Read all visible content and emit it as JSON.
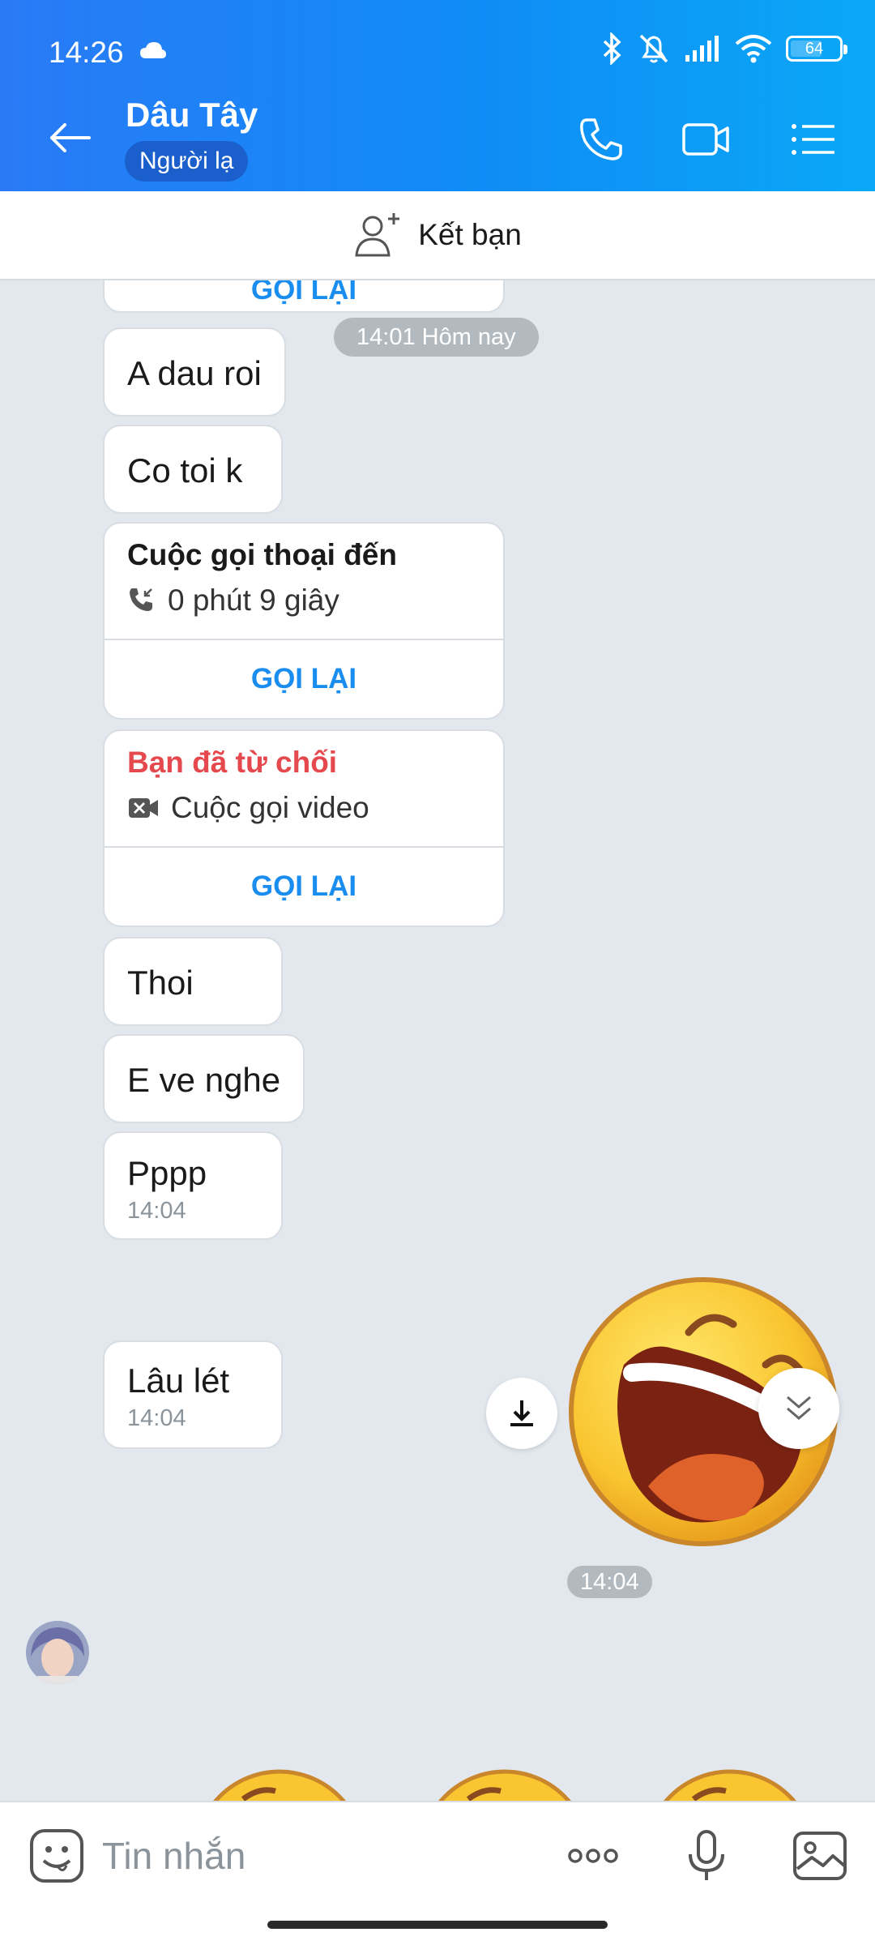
{
  "status_bar": {
    "time": "14:26",
    "battery": "64"
  },
  "header": {
    "contact_name": "Dâu Tây",
    "badge": "Người lạ"
  },
  "friend_bar": {
    "label": "Kết bạn"
  },
  "chat": {
    "top_partial_action": "GỌI LẠI",
    "date_pill": "14:01 Hôm nay",
    "messages": [
      {
        "text": "A dau roi"
      },
      {
        "text": "Co toi k"
      },
      {
        "text": "Thoi"
      },
      {
        "text": "E ve nghe"
      },
      {
        "text": "Pppp",
        "time": "14:04"
      },
      {
        "text": "Lâu lét",
        "time": "14:04"
      }
    ],
    "call_incoming": {
      "title": "Cuộc gọi thoại đến",
      "detail": "0 phút 9 giây",
      "action": "GỌI LẠI"
    },
    "call_declined": {
      "title": "Bạn đã từ chối",
      "detail": "Cuộc gọi video",
      "action": "GỌI LẠI",
      "title_color": "#e5484d"
    },
    "sticker_time": "14:04"
  },
  "input_bar": {
    "placeholder": "Tin nhắn"
  },
  "colors": {
    "accent": "#1a8df0",
    "header_start": "#2a7af6",
    "header_end": "#0aa8f7",
    "chat_bg": "#e2e8ee"
  },
  "icons": [
    "back-arrow-icon",
    "phone-icon",
    "video-call-icon",
    "menu-list-icon",
    "add-friend-icon",
    "sticker-icon",
    "more-icon",
    "microphone-icon",
    "image-icon",
    "download-icon",
    "chevron-down-icon"
  ]
}
